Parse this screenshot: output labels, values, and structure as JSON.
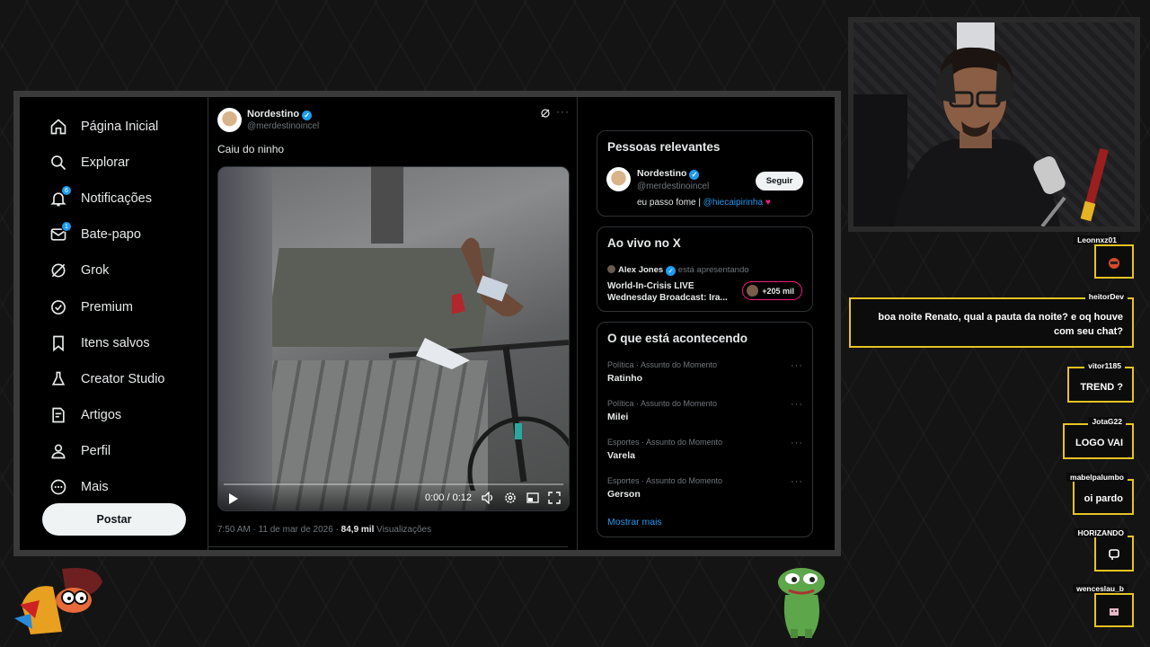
{
  "nav": {
    "items": [
      {
        "label": "Página Inicial",
        "icon": "home-icon"
      },
      {
        "label": "Explorar",
        "icon": "search-icon"
      },
      {
        "label": "Notificações",
        "icon": "bell-icon",
        "badge": "6"
      },
      {
        "label": "Bate-papo",
        "icon": "mail-icon",
        "badge": "1"
      },
      {
        "label": "Grok",
        "icon": "grok-icon"
      },
      {
        "label": "Premium",
        "icon": "premium-icon"
      },
      {
        "label": "Itens salvos",
        "icon": "bookmark-icon"
      },
      {
        "label": "Creator Studio",
        "icon": "creator-studio-icon"
      },
      {
        "label": "Artigos",
        "icon": "articles-icon"
      },
      {
        "label": "Perfil",
        "icon": "person-icon"
      },
      {
        "label": "Mais",
        "icon": "more-circle-icon"
      }
    ],
    "post_label": "Postar"
  },
  "tweet": {
    "author": "Nordestino",
    "handle": "@merdestinoincel",
    "text": "Caiu do ninho",
    "video": {
      "time": "0:00 / 0:12"
    },
    "meta_time": "7:50 AM · 11 de mar de 2026 · ",
    "views_count": "84,9 mil",
    "views_label": " Visualizações"
  },
  "sidebar": {
    "people": {
      "title": "Pessoas relevantes",
      "name": "Nordestino",
      "handle": "@merdestinoincel",
      "bio_text": "eu passo fome | ",
      "bio_link": "@hiecaipirinha",
      "bio_heart": "♥",
      "follow_label": "Seguir"
    },
    "live": {
      "title": "Ao vivo no X",
      "host": "Alex Jones",
      "host_suffix": " está apresentando",
      "title_line1": "World-In-Crisis LIVE",
      "title_line2": "Wednesday Broadcast: Ira...",
      "listeners": "+205 mil"
    },
    "trends": {
      "title": "O que está acontecendo",
      "items": [
        {
          "category": "Política · Assunto do Momento",
          "name": "Ratinho"
        },
        {
          "category": "Política · Assunto do Momento",
          "name": "Milei"
        },
        {
          "category": "Esportes · Assunto do Momento",
          "name": "Varela"
        },
        {
          "category": "Esportes · Assunto do Momento",
          "name": "Gerson"
        }
      ],
      "show_more": "Mostrar mais"
    }
  },
  "chat": [
    {
      "user": "Leonnxz01",
      "message": ""
    },
    {
      "user": "heitorDev",
      "message": "boa noite Renato, qual a pauta da noite? e oq houve com seu chat?"
    },
    {
      "user": "vitor1185",
      "message": "TREND ?"
    },
    {
      "user": "JotaG22",
      "message": "LOGO VAI"
    },
    {
      "user": "mabelpalumbo",
      "message": "oi pardo"
    },
    {
      "user": "HORIZANDO",
      "message": ""
    },
    {
      "user": "wenceslau_b",
      "message": ""
    }
  ],
  "colors": {
    "accent": "#1d9bf0",
    "chat_border": "#e6c322",
    "live_ring": "#f91880"
  }
}
